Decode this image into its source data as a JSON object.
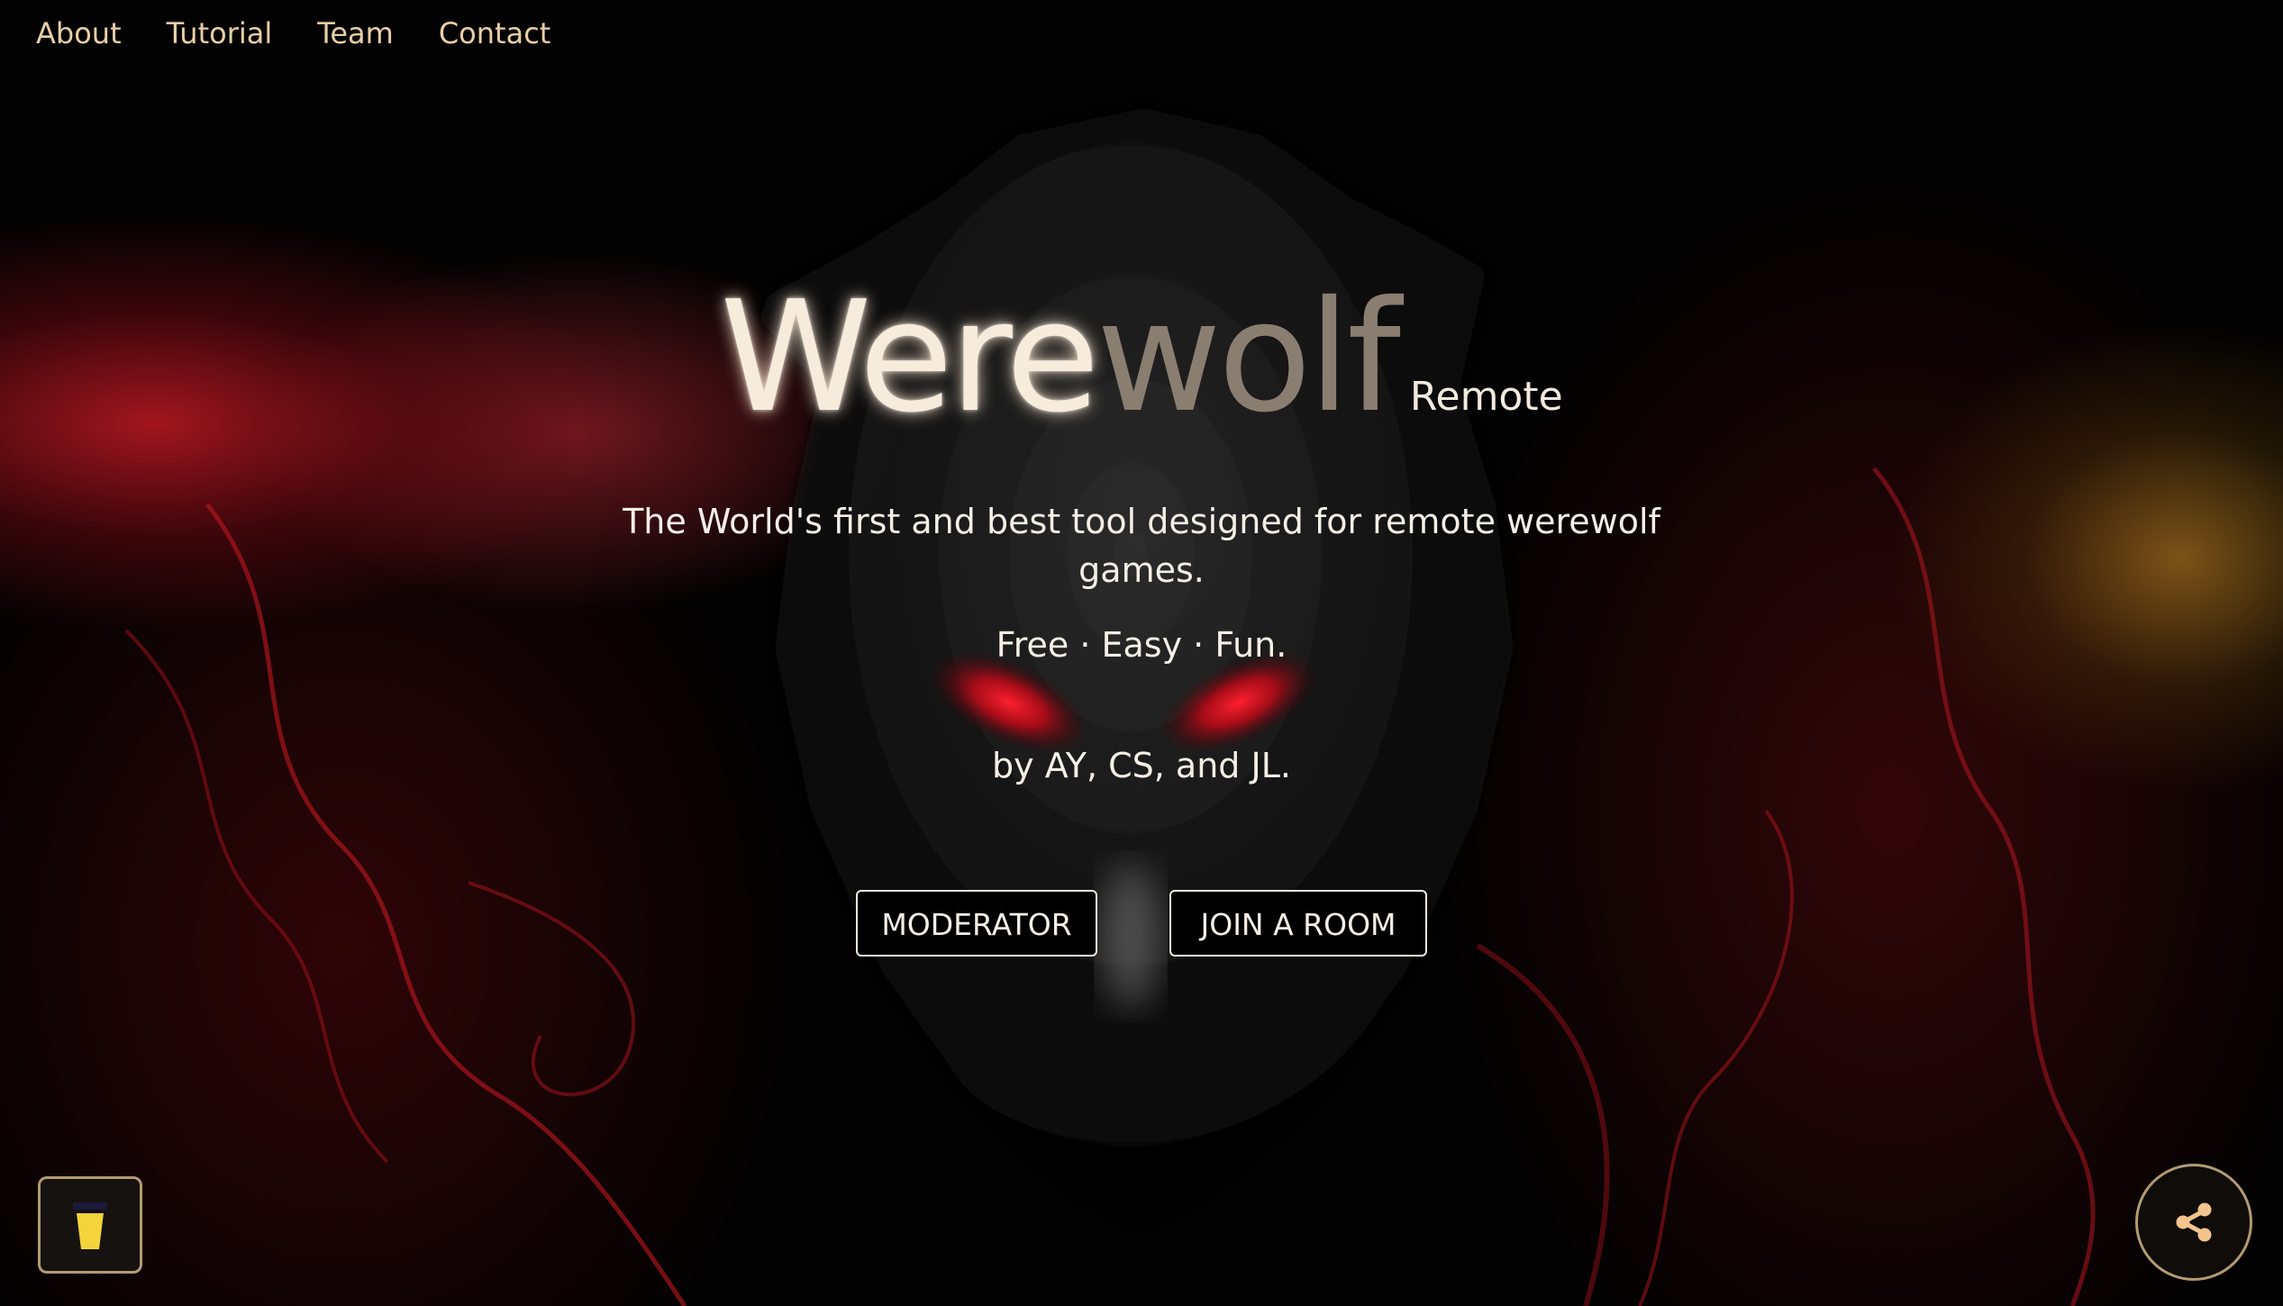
{
  "nav": {
    "items": [
      {
        "label": "About"
      },
      {
        "label": "Tutorial"
      },
      {
        "label": "Team"
      },
      {
        "label": "Contact"
      }
    ]
  },
  "hero": {
    "title_part1": "Were",
    "title_part2": "wolf",
    "title_suffix": "Remote",
    "tagline": "The World's first and best tool designed for remote werewolf games.",
    "motto": "Free · Easy · Fun.",
    "authors": "by AY, CS, and JL."
  },
  "actions": {
    "moderator_label": "MODERATOR",
    "join_label": "JOIN A ROOM"
  },
  "widgets": {
    "coffee_icon": "coffee-cup-icon",
    "share_icon": "share-icon"
  },
  "colors": {
    "nav_text": "#e8cfa6",
    "title_glow": "#f7ecdc",
    "title_dim": "#8a7e70",
    "accent_red": "#c0181f",
    "accent_gold": "#b39a72",
    "share_icon": "#f3c58c",
    "coffee_icon": "#f5d33a"
  }
}
